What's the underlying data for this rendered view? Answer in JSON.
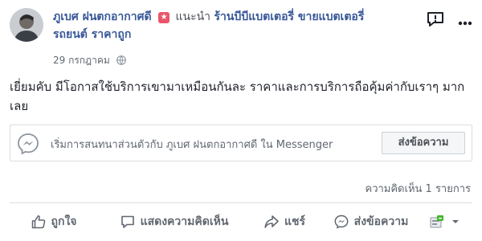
{
  "post": {
    "author_name": "ภูเบศ ฝนตกอากาศดี",
    "recommends_text": "แนะนำ",
    "page_name_line1": "ร้านบีบีแบตเตอรี่ ขายแบตเตอรี่",
    "page_name_line2": "รถยนต์ ราคาถูก",
    "date": "29 กรกฎาคม",
    "privacy_icon": "globe-icon",
    "text": "เยี่ยมคับ มีโอกาสใช้บริการเขามาเหมือนกันละ ราคาและการบริการถือคุ้มค่ากับเราๆ มากเลย"
  },
  "top_actions": {
    "icons": [
      "feedback-icon",
      "more-icon"
    ]
  },
  "messenger": {
    "prompt": "เริ่มการสนทนาส่วนตัวกับ ภูเบศ ฝนตกอากาศดี ใน Messenger",
    "button_label": "ส่งข้อความ",
    "icon": "messenger-icon"
  },
  "engagement": {
    "comment_count": "ความคิดเห็น 1 รายการ"
  },
  "actions": {
    "like": "ถูกใจ",
    "comment": "แสดงความคิดเห็น",
    "share": "แชร์",
    "send": "ส่งข้อความ"
  },
  "colors": {
    "link": "#385898",
    "star_badge": "#e9566a",
    "viewer_badge": "#42b72a",
    "secondary_text": "#606770",
    "border": "#dadde1"
  }
}
